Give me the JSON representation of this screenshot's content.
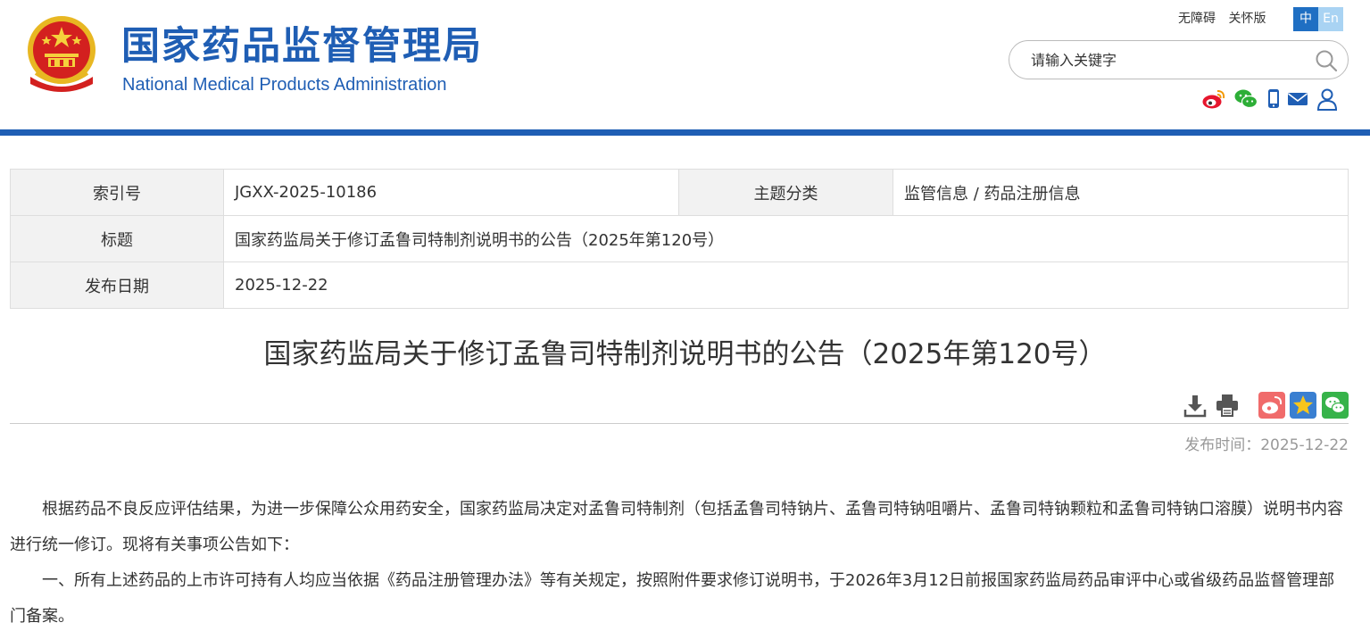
{
  "header": {
    "title_cn": "国家药品监督管理局",
    "title_en": "National Medical Products Administration",
    "links": [
      "无障碍",
      "关怀版"
    ],
    "lang": [
      "中",
      "En"
    ],
    "search_placeholder": "请输入关键字"
  },
  "social_icons": [
    "weibo-icon",
    "wechat-icon",
    "mobile-icon",
    "mail-icon",
    "user-icon"
  ],
  "info": {
    "index_label": "索引号",
    "index_value": "JGXX-2025-10186",
    "topic_label": "主题分类",
    "topic_value": "监管信息 / 药品注册信息",
    "title_label": "标题",
    "title_value": "国家药监局关于修订孟鲁司特制剂说明书的公告（2025年第120号）",
    "date_label": "发布日期",
    "date_value": "2025-12-22"
  },
  "article": {
    "title": "国家药监局关于修订孟鲁司特制剂说明书的公告（2025年第120号）",
    "pubtime_label": "发布时间：",
    "pubtime_value": "2025-12-22",
    "paragraphs": [
      "根据药品不良反应评估结果，为进一步保障公众用药安全，国家药监局决定对孟鲁司特制剂（包括孟鲁司特钠片、孟鲁司特钠咀嚼片、孟鲁司特钠颗粒和孟鲁司特钠口溶膜）说明书内容进行统一修订。现将有关事项公告如下：",
      "一、所有上述药品的上市许可持有人均应当依据《药品注册管理办法》等有关规定，按照附件要求修订说明书，于2026年3月12日前报国家药监局药品审评中心或省级药品监督管理部门备案。"
    ]
  },
  "colors": {
    "brand_blue": "#1f5eb4",
    "lang_active": "#1f6fc3",
    "lang_inactive": "#a9d3f3",
    "label_bg": "#f2f2f2"
  }
}
